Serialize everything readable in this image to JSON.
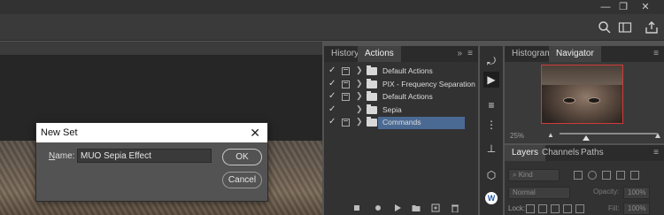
{
  "dialog": {
    "title": "New Set",
    "name_label_hot": "N",
    "name_label_rest": "ame:",
    "name_value": "MUO Sepia Effect",
    "ok_label": "OK",
    "cancel_label": "Cancel",
    "close_glyph": "✕"
  },
  "actions_panel": {
    "tabs": [
      "History",
      "Actions"
    ],
    "active_tab": "Actions",
    "collapse_glyph": "»",
    "menu_glyph": "≡",
    "items": [
      {
        "label": "Default Actions",
        "checked": true,
        "dialog_toggle": true,
        "selected": false
      },
      {
        "label": "PIX - Frequency Separation",
        "checked": true,
        "dialog_toggle": true,
        "selected": false
      },
      {
        "label": "Default Actions",
        "checked": true,
        "dialog_toggle": true,
        "selected": false
      },
      {
        "label": "Sepia",
        "checked": true,
        "dialog_toggle": false,
        "selected": false
      },
      {
        "label": "Commands",
        "checked": true,
        "dialog_toggle": true,
        "selected": true
      }
    ],
    "footer_icons": [
      "stop-icon",
      "record-icon",
      "play-icon",
      "new-set-icon",
      "new-action-icon",
      "delete-icon"
    ]
  },
  "navigator_panel": {
    "tabs": [
      "Histogram",
      "Navigator"
    ],
    "active_tab": "Navigator",
    "zoom": "25%"
  },
  "layers_panel": {
    "tabs": [
      "Layers",
      "Channels",
      "Paths"
    ],
    "active_tab": "Layers",
    "kind_placeholder": "Kind",
    "blend_mode": "Normal",
    "opacity_label": "Opacity:",
    "opacity_value": "100%",
    "lock_label": "Lock:",
    "fill_label": "Fill:",
    "fill_value": "100%"
  },
  "colors": {
    "selection": "#4b6a93",
    "navigator_frame": "#d23a3a",
    "panel_bg": "#323232",
    "tab_bar": "#2b2b2b"
  }
}
